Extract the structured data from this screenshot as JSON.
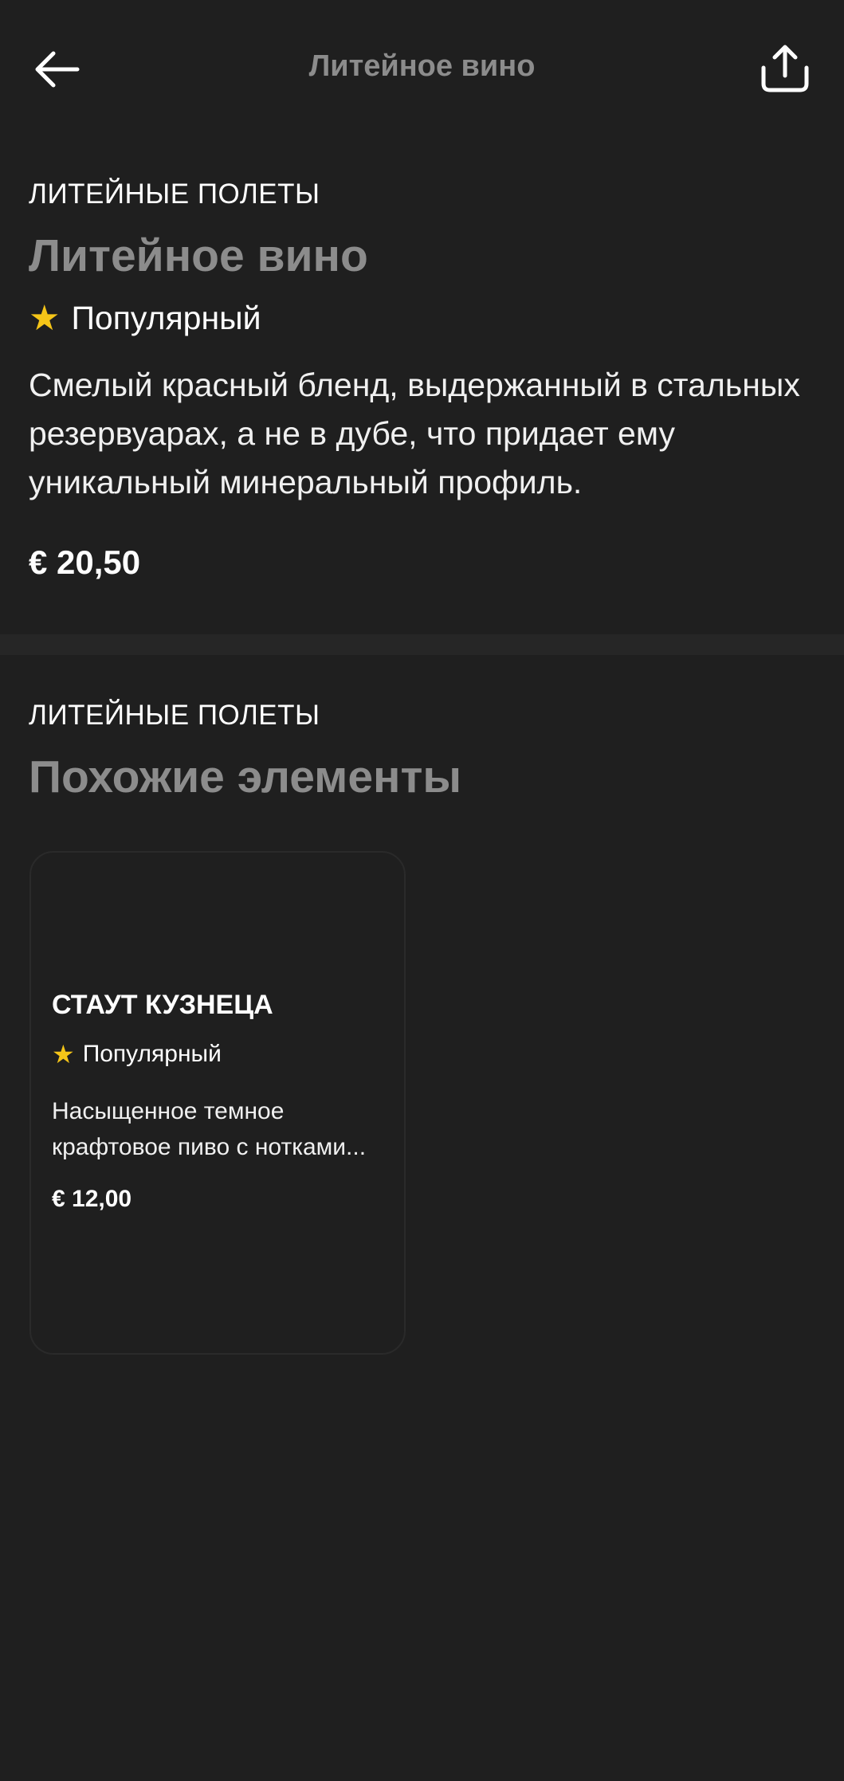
{
  "header": {
    "title": "Литейное вино",
    "back_icon": "arrow-left-icon",
    "share_icon": "share-icon"
  },
  "product": {
    "category": "ЛИТЕЙНЫЕ ПОЛЕТЫ",
    "name": "Литейное вино",
    "badge": "Популярный",
    "description": "Смелый красный бленд, выдержанный в стальных резервуарах, а не в дубе, что придает ему уникальный минеральный профиль.",
    "price": "€ 20,50"
  },
  "similar": {
    "category": "ЛИТЕЙНЫЕ ПОЛЕТЫ",
    "heading": "Похожие элементы",
    "items": [
      {
        "name": "СТАУТ КУЗНЕЦА",
        "badge": "Популярный",
        "description_line1": "Насыщенное темное",
        "description_line2": "крафтовое пиво с нотками...",
        "price": "€ 12,00"
      }
    ]
  },
  "colors": {
    "background": "#1f1f1f",
    "muted_title": "#8c8c8c",
    "star": "#f5c518"
  }
}
